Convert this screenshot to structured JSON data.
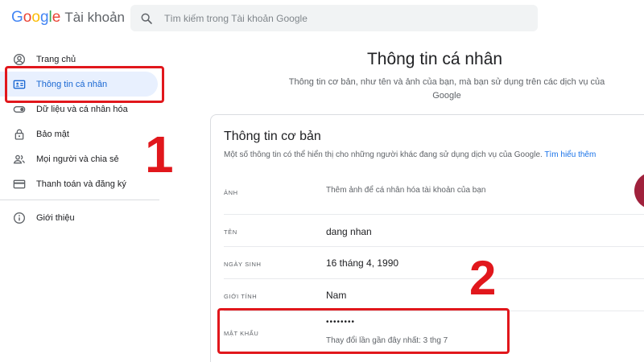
{
  "header": {
    "logo_letters": [
      {
        "ch": "G",
        "color": "#4285F4"
      },
      {
        "ch": "o",
        "color": "#EA4335"
      },
      {
        "ch": "o",
        "color": "#FBBC05"
      },
      {
        "ch": "g",
        "color": "#4285F4"
      },
      {
        "ch": "l",
        "color": "#34A853"
      },
      {
        "ch": "e",
        "color": "#EA4335"
      }
    ],
    "product": "Tài khoản",
    "search_placeholder": "Tìm kiếm trong Tài khoản Google"
  },
  "sidebar": {
    "items": [
      {
        "label": "Trang chủ",
        "icon": "account-circle-icon"
      },
      {
        "label": "Thông tin cá nhân",
        "icon": "id-card-icon",
        "active": true
      },
      {
        "label": "Dữ liệu và cá nhân hóa",
        "icon": "toggle-icon"
      },
      {
        "label": "Bảo mật",
        "icon": "lock-icon"
      },
      {
        "label": "Mọi người và chia sẻ",
        "icon": "people-icon"
      },
      {
        "label": "Thanh toán và đăng ký",
        "icon": "credit-card-icon"
      }
    ],
    "footer_item": {
      "label": "Giới thiệu",
      "icon": "info-icon"
    }
  },
  "main": {
    "title": "Thông tin cá nhân",
    "subtitle": "Thông tin cơ bản, như tên và ảnh của bạn, mà bạn sử dụng trên các dịch vụ của Google"
  },
  "card": {
    "title": "Thông tin cơ bản",
    "description": "Một số thông tin có thể hiển thị cho những người khác đang sử dụng dịch vụ của Google.",
    "learn_more": "Tìm hiểu thêm",
    "rows": {
      "photo": {
        "label": "Ảnh",
        "value": "Thêm ảnh để cá nhân hóa tài khoản của bạn"
      },
      "name": {
        "label": "Tên",
        "value": "dang nhan"
      },
      "birthday": {
        "label": "Ngày sinh",
        "value": "16 tháng 4, 1990"
      },
      "gender": {
        "label": "Giới tính",
        "value": "Nam"
      },
      "password": {
        "label": "Mật khẩu",
        "value": "••••••••",
        "sub": "Thay đổi lần gần đây nhất: 3 thg 7"
      }
    }
  },
  "annotations": {
    "one": "1",
    "two": "2"
  },
  "colors": {
    "accent": "#1967d2",
    "active_bg": "#e8f0fe",
    "highlight": "#e1171c"
  }
}
